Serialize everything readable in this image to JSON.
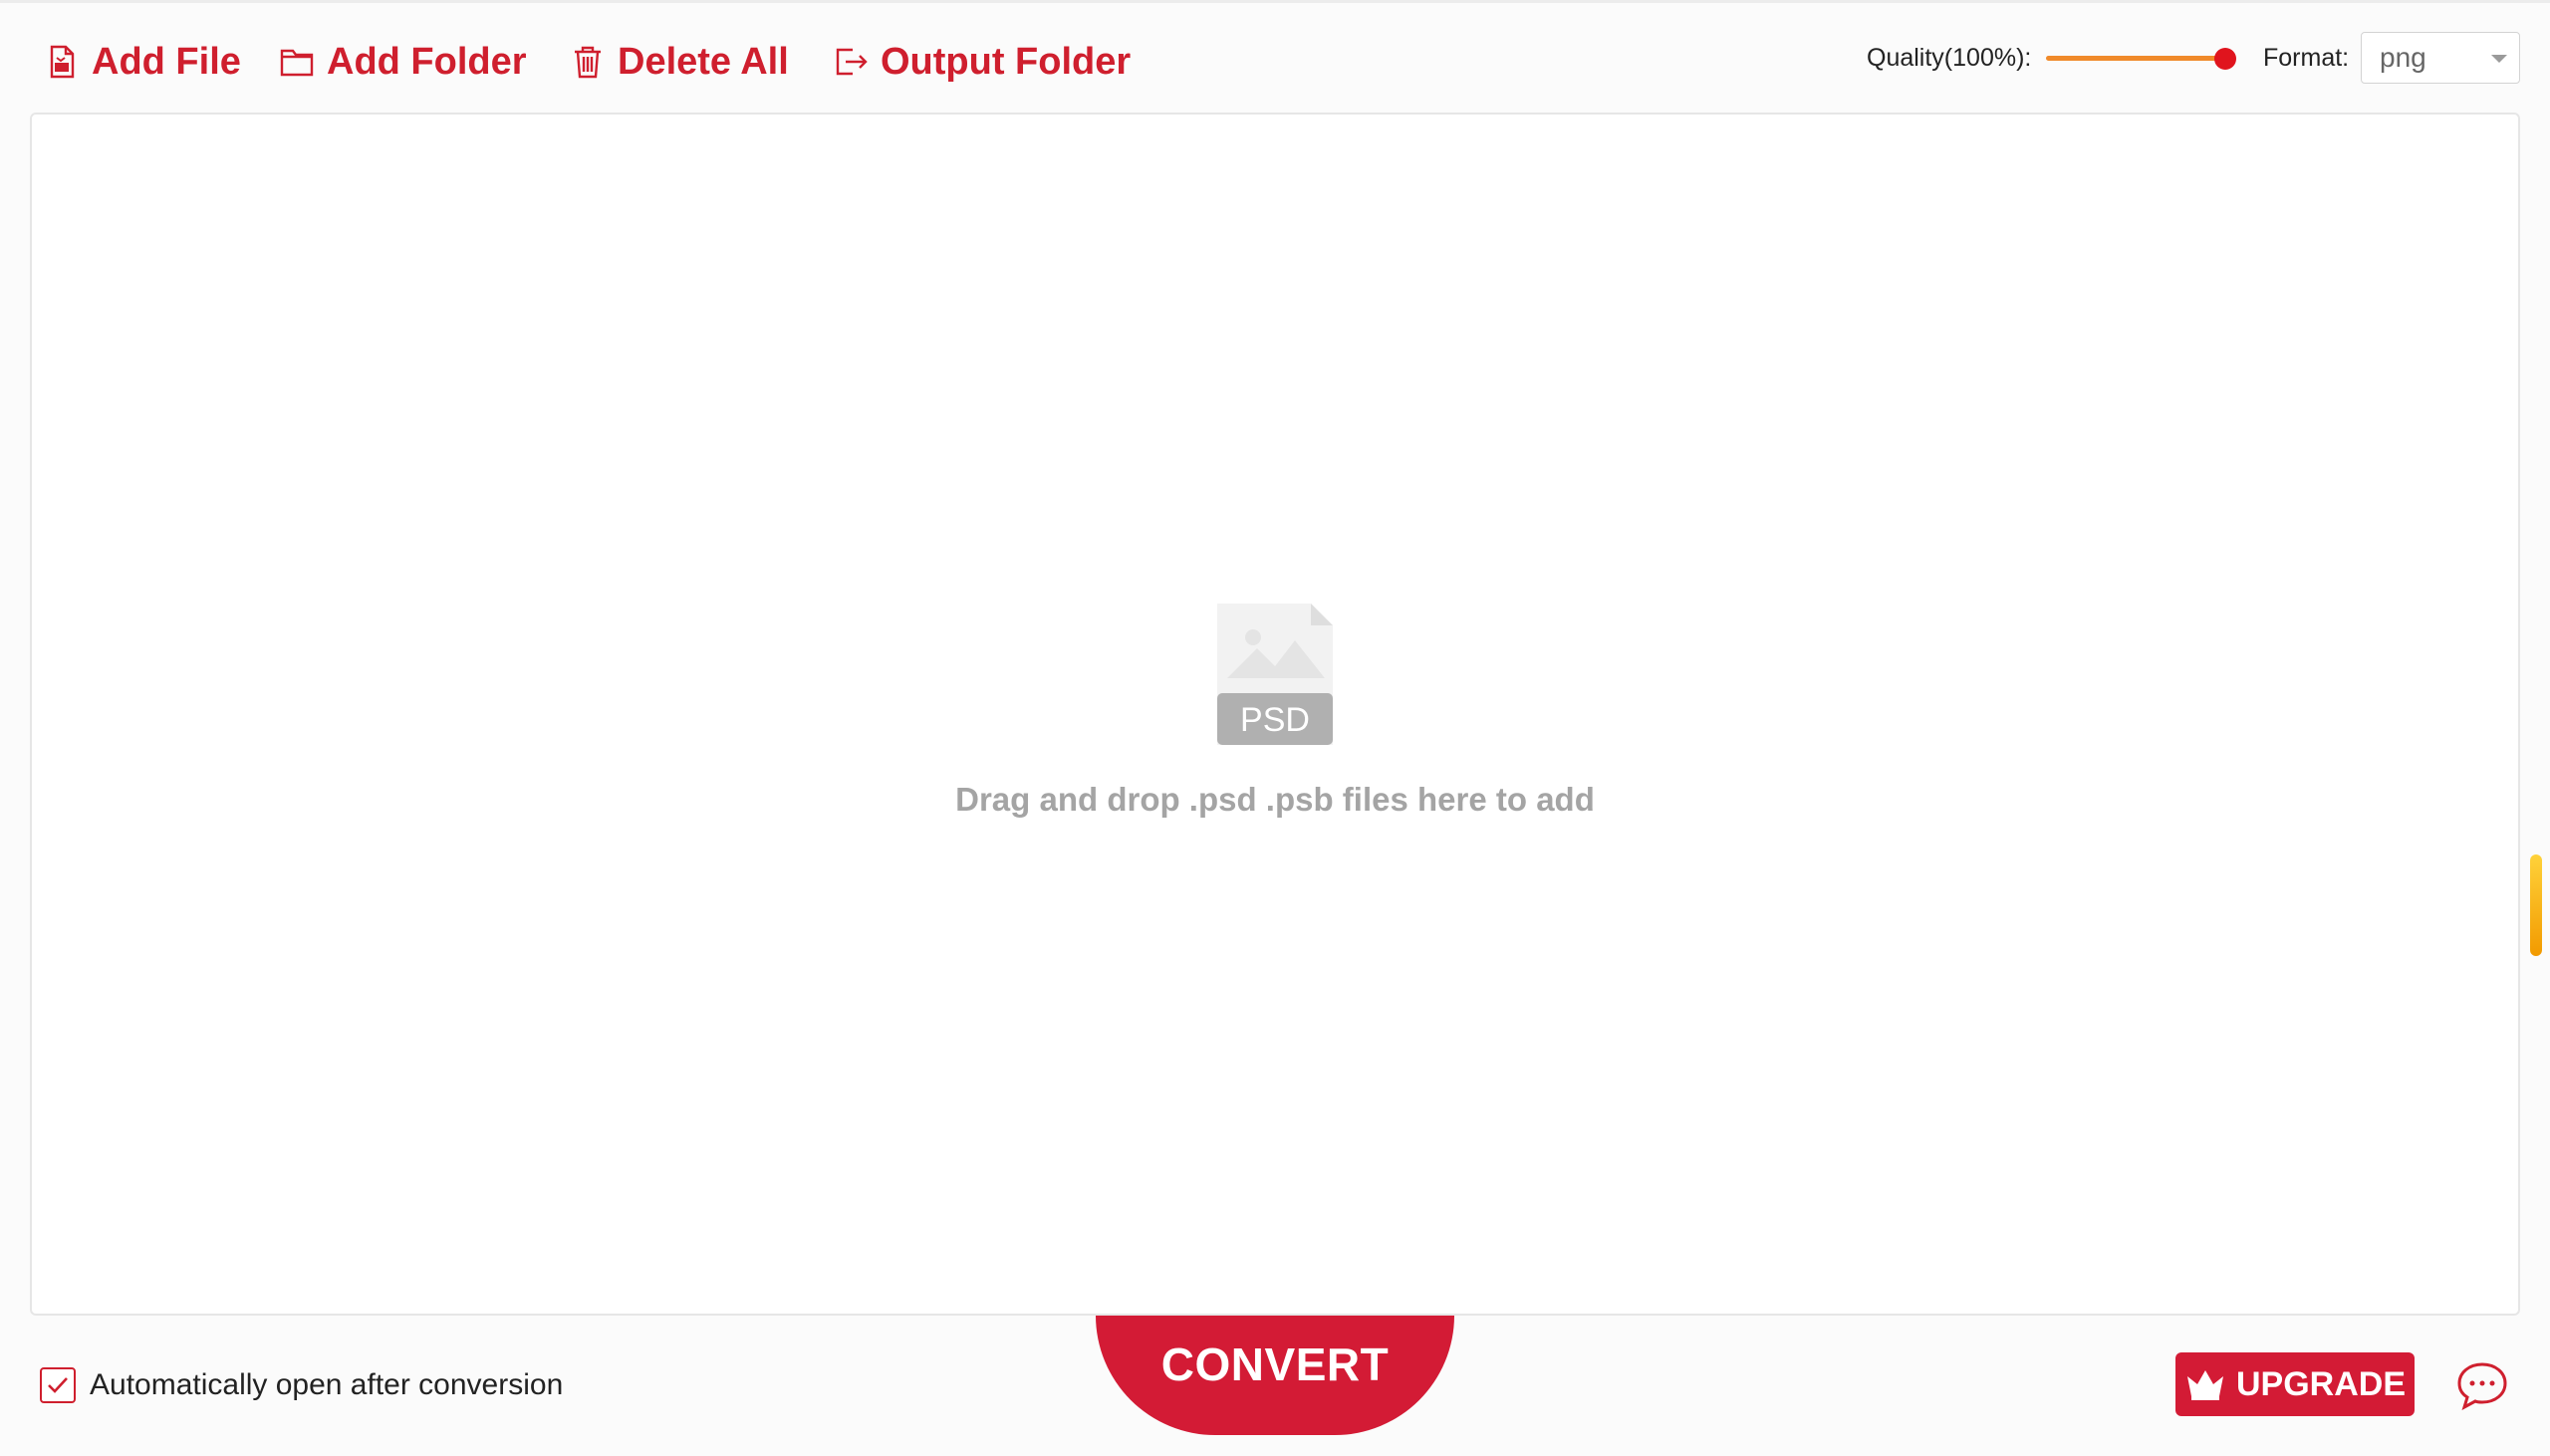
{
  "toolbar": {
    "add_file": "Add File",
    "add_folder": "Add Folder",
    "delete_all": "Delete All",
    "output_folder": "Output Folder",
    "quality_label": "Quality(100%):",
    "quality_value": 1.0,
    "format_label": "Format:",
    "format_value": "png"
  },
  "dropzone": {
    "icon_text": "PSD",
    "hint": "Drag and drop .psd .psb files here to add"
  },
  "footer": {
    "auto_open_label": "Automatically open after conversion",
    "auto_open_checked": true,
    "convert_label": "CONVERT",
    "upgrade_label": "UPGRADE"
  },
  "colors": {
    "accent": "#cf1f2e",
    "convert": "#d31b35",
    "slider_track": "#f08a2a",
    "slider_thumb": "#e0141d",
    "hint_text": "#a4a4a4"
  },
  "icons": [
    "add-file-icon",
    "add-folder-icon",
    "delete-icon",
    "output-folder-icon",
    "psd-file-icon",
    "checkmark-icon",
    "crown-icon",
    "chat-icon"
  ]
}
